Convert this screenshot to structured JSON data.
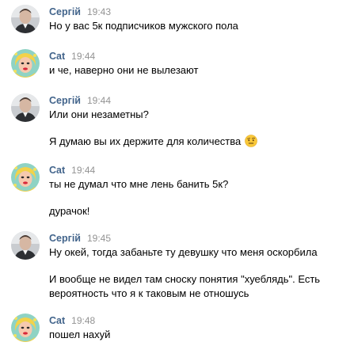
{
  "messages": [
    {
      "author": "Сергій",
      "time": "19:43",
      "lines": [
        "Но у вас 5к подписчиков мужского пола"
      ]
    },
    {
      "author": "Cat",
      "time": "19:44",
      "lines": [
        "и че, наверно они не вылезают"
      ]
    },
    {
      "author": "Сергій",
      "time": "19:44",
      "lines": [
        "Или они незаметны?",
        "Я думаю вы их держите для количества"
      ],
      "emoji": "face-with-raised-eyebrow-emoji"
    },
    {
      "author": "Cat",
      "time": "19:44",
      "lines": [
        "ты не думал что мне лень банить 5к?",
        "дурачок!"
      ]
    },
    {
      "author": "Сергій",
      "time": "19:45",
      "lines": [
        "Ну окей, тогда забаньте ту девушку что меня оскорбила",
        "И вообще не видел там сноску понятия \"хуеблядь\". Есть",
        "вероятность что я к таковым не отношусь"
      ]
    },
    {
      "author": "Cat",
      "time": "19:48",
      "lines": [
        "пошел нахуй"
      ]
    }
  ],
  "colors": {
    "author": "#42648b",
    "time": "#939393",
    "text": "#000000"
  },
  "icons": {
    "user_avatar": "man-portrait-avatar-icon",
    "cat_avatar": "pop-art-woman-avatar-icon"
  }
}
